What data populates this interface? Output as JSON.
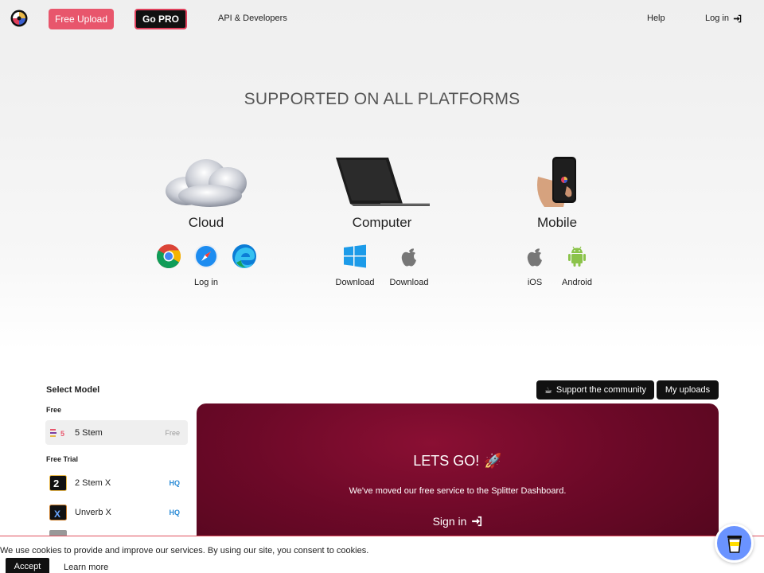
{
  "nav": {
    "free_upload": "Free Upload",
    "go_pro": "Go PRO",
    "api": "API & Developers",
    "help": "Help",
    "login": "Log in"
  },
  "platforms": {
    "title": "SUPPORTED ON ALL PLATFORMS",
    "cloud": {
      "label": "Cloud",
      "browsers": [
        "chrome-icon",
        "safari-icon",
        "edge-icon"
      ],
      "caption": "Log in"
    },
    "computer": {
      "label": "Computer",
      "windows_caption": "Download",
      "mac_caption": "Download"
    },
    "mobile": {
      "label": "Mobile",
      "ios_caption": "iOS",
      "android_caption": "Android"
    }
  },
  "models": {
    "title": "Select Model",
    "free_label": "Free",
    "trial_label": "Free Trial",
    "items": [
      {
        "name": "5 Stem",
        "tag": "Free",
        "icon_text": "5"
      },
      {
        "name": "2 Stem X",
        "tag": "HQ",
        "icon_text": "2"
      },
      {
        "name": "Unverb X",
        "tag": "HQ",
        "icon_text": "X"
      }
    ]
  },
  "actions": {
    "support": "Support the community",
    "uploads": "My uploads"
  },
  "hero": {
    "title": "LETS GO!",
    "subtitle": "We've moved our free service to the Splitter Dashboard.",
    "sign_in": "Sign in"
  },
  "cookie": {
    "text": "We use cookies to provide and improve our services. By using our site, you consent to cookies.",
    "accept": "Accept",
    "learn_more": "Learn more"
  },
  "colors": {
    "upload_pink": "#e8566c",
    "hero_crimson": "#6d0928",
    "hq_blue": "#2a8bd6",
    "android_green": "#8bc34a",
    "bmc_blue": "#6a93ff"
  }
}
